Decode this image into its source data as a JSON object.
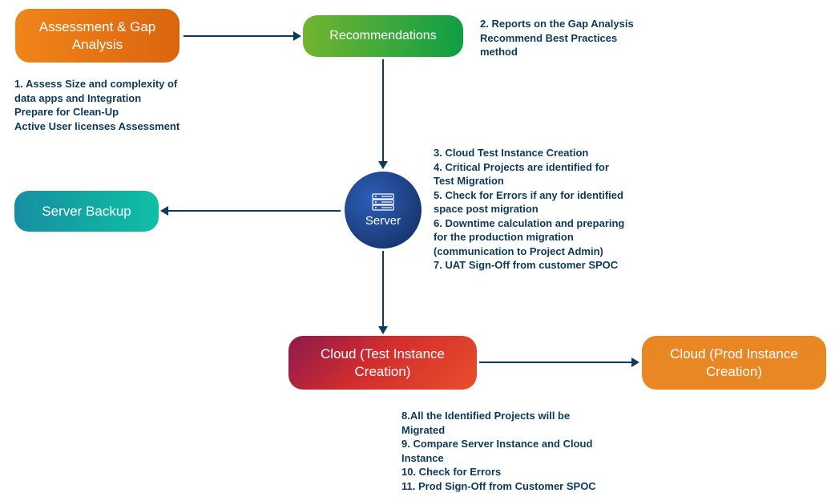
{
  "nodes": {
    "assessment": {
      "label": "Assessment &\nGap Analysis"
    },
    "recommendations": {
      "label": "Recommendations"
    },
    "server_backup": {
      "label": "Server Backup"
    },
    "server": {
      "label": "Server"
    },
    "cloud_test": {
      "label": "Cloud\n(Test Instance Creation)"
    },
    "cloud_prod": {
      "label": "Cloud\n(Prod Instance Creation)"
    }
  },
  "notes": {
    "n1": "1. Assess Size and complexity of\ndata apps and Integration\nPrepare for Clean-Up\nActive User licenses Assessment",
    "n2": "2. Reports on the Gap Analysis\nRecommend Best Practices\nmethod",
    "n3": "3. Cloud Test Instance Creation\n4. Critical Projects are identified for\nTest Migration\n5. Check for Errors if any for identified\nspace post migration\n6. Downtime calculation and preparing\nfor the production migration\n(communication to Project Admin)\n7. UAT Sign-Off from customer SPOC",
    "n4": "8.All the Identified Projects will be\nMigrated\n9. Compare Server Instance and Cloud\nInstance\n10. Check for Errors\n11. Prod Sign-Off from Customer SPOC"
  }
}
